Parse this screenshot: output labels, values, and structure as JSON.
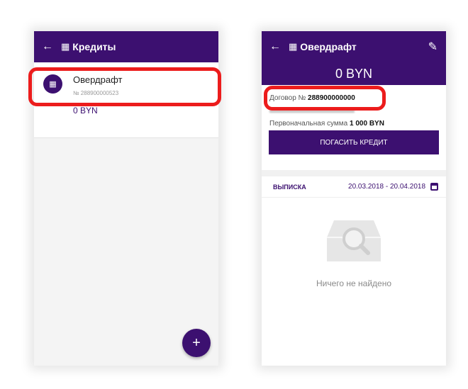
{
  "left_screen": {
    "title": "Кредиты",
    "back_icon": "arrow-left-icon",
    "title_icon": "coins-icon",
    "loan": {
      "name": "Овердрафт",
      "number": "№ 288900000523",
      "amount": "0 BYN"
    },
    "fab_label": "+"
  },
  "right_screen": {
    "title": "Овердрафт",
    "back_icon": "arrow-left-icon",
    "edit_icon": "pencil-icon",
    "balance": "0 BYN",
    "contract_label": "Договор №",
    "contract_value": "288900000000",
    "initial_label": "Первоначальная сумма",
    "initial_value": "1 000 BYN",
    "pay_button": "ПОГАСИТЬ КРЕДИТ",
    "statement_label": "ВЫПИСКА",
    "date_range": "20.03.2018 - 20.04.2018",
    "empty_text": "Ничего не найдено"
  },
  "colors": {
    "brand": "#3c1070",
    "highlight": "#ec1c1c"
  }
}
